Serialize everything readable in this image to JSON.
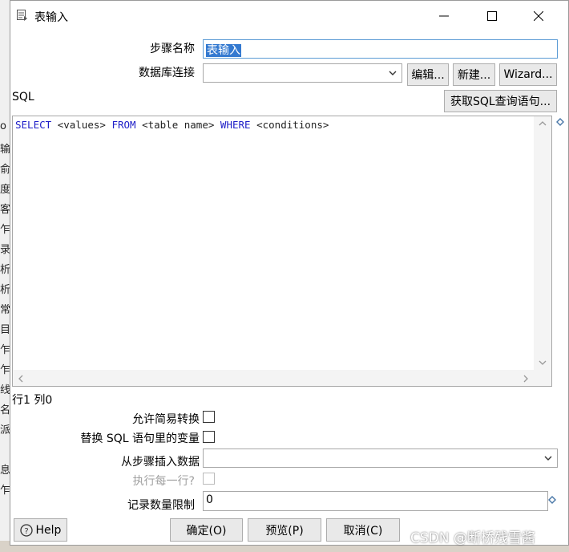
{
  "window": {
    "title": "表输入",
    "minimize_glyph": "—",
    "maximize_glyph": "☐",
    "close_glyph": "✕"
  },
  "form": {
    "step_name_label": "步骤名称",
    "step_name_value": "表输入",
    "db_connection_label": "数据库连接",
    "db_connection_value": "",
    "edit_button": "编辑...",
    "new_button": "新建...",
    "wizard_button": "Wizard...",
    "sql_label": "SQL",
    "get_sql_button": "获取SQL查询语句...",
    "sql_tokens": {
      "select": "SELECT",
      "values": "<values>",
      "from": "FROM",
      "table": "<table name>",
      "where": "WHERE",
      "conditions": "<conditions>"
    },
    "cursor_position": "行1 列0",
    "lazy_conversion_label": "允许简易转换",
    "replace_variables_label": "替换 SQL 语句里的变量",
    "insert_from_step_label": "从步骤插入数据",
    "insert_from_step_value": "",
    "execute_each_row_label": "执行每一行?",
    "limit_label": "记录数量限制",
    "limit_value": "0"
  },
  "footer": {
    "help_button": "Help",
    "ok_button": "确定(O)",
    "preview_button": "预览(P)",
    "cancel_button": "取消(C)"
  },
  "background_app": {
    "side_chars": [
      "o",
      "输",
      "俞",
      "度",
      "客",
      "乍",
      "录",
      "析",
      "析",
      "常",
      "目",
      "乍",
      "乍",
      "线",
      "名",
      "派",
      "息",
      "乍"
    ]
  },
  "watermark": "CSDN @断桥残雪酱",
  "colors": {
    "keyword": "#2020c8",
    "selection": "#3379d0",
    "focus_border": "#5b9bd5"
  }
}
